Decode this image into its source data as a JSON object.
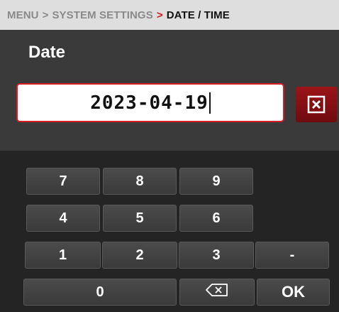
{
  "breadcrumb": {
    "items": [
      "MENU",
      "SYSTEM SETTINGS",
      "DATE / TIME"
    ],
    "separator": ">"
  },
  "field": {
    "title": "Date",
    "value": "2023-04-19"
  },
  "clear_button": {
    "icon": "close-box-icon"
  },
  "keypad": {
    "rows": [
      [
        "7",
        "8",
        "9"
      ],
      [
        "4",
        "5",
        "6"
      ],
      [
        "1",
        "2",
        "3",
        "-"
      ]
    ],
    "zero": "0",
    "backspace_icon": "backspace-icon",
    "ok": "OK"
  },
  "colors": {
    "accent": "#d31e26",
    "background": "#242424",
    "panel": "#3a3a3a",
    "key": "#444444",
    "breadcrumb_bg": "#dedede"
  }
}
